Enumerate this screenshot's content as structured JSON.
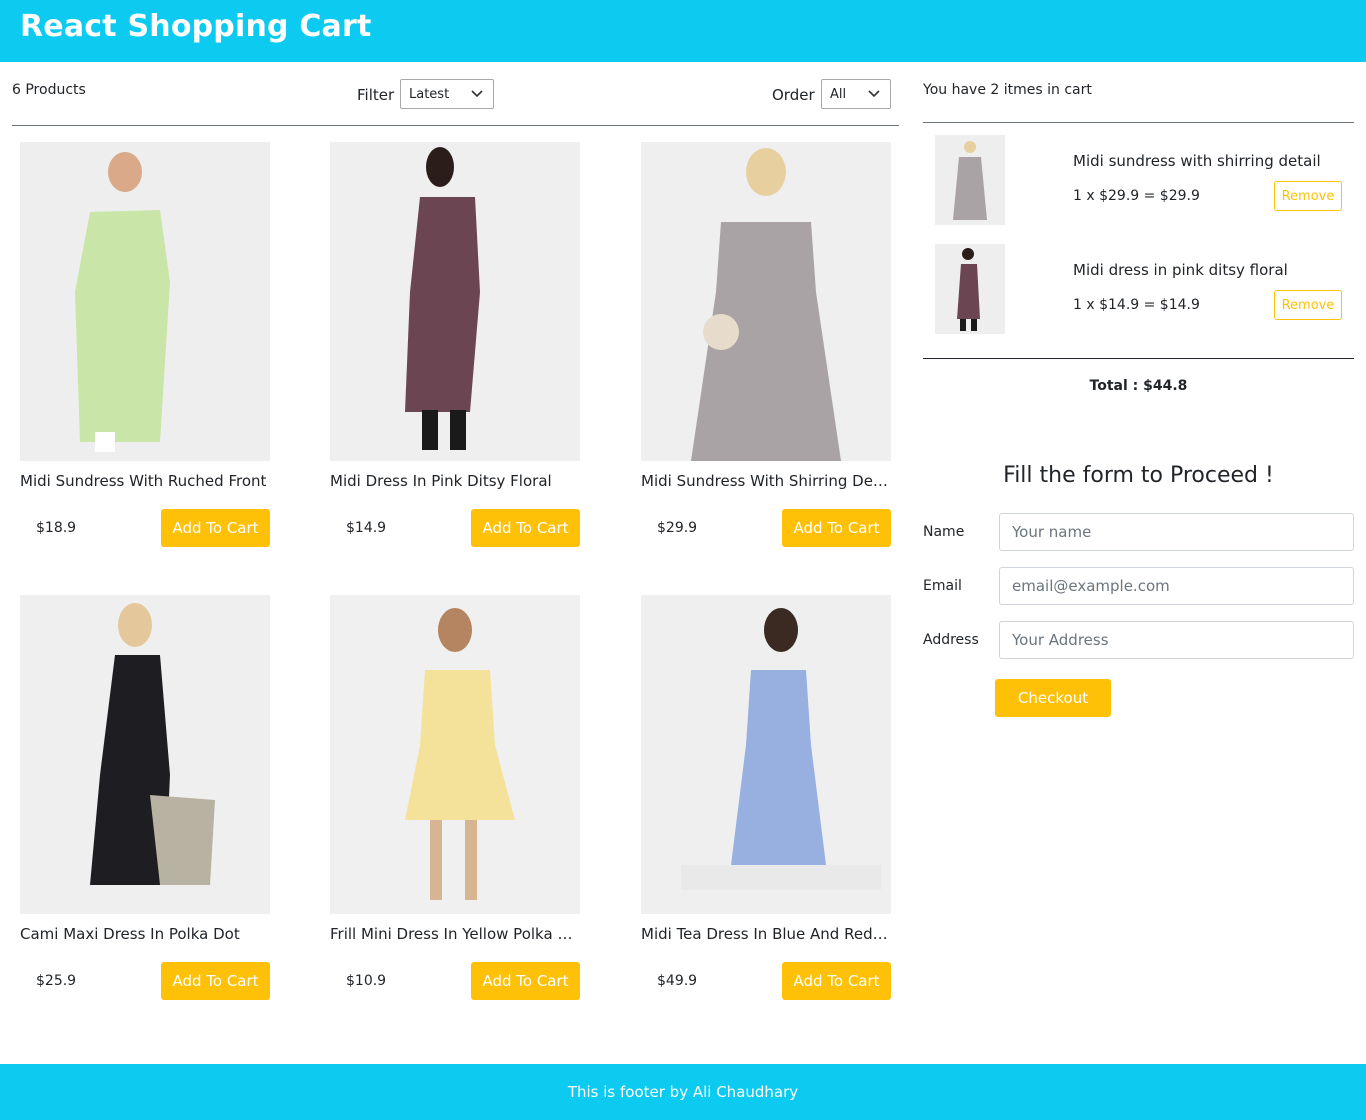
{
  "header": {
    "title": "React Shopping Cart"
  },
  "filter": {
    "count": "6 Products",
    "filter_label": "Filter",
    "filter_value": "Latest",
    "order_label": "Order",
    "order_value": "All"
  },
  "products": [
    {
      "name": "Midi Sundress With Ruched Front",
      "price": "$18.9",
      "button": "Add To Cart"
    },
    {
      "name": "Midi Dress In Pink Ditsy Floral",
      "price": "$14.9",
      "button": "Add To Cart"
    },
    {
      "name": "Midi Sundress With Shirring Detail",
      "price": "$29.9",
      "button": "Add To Cart"
    },
    {
      "name": "Cami Maxi Dress In Polka Dot",
      "price": "$25.9",
      "button": "Add To Cart"
    },
    {
      "name": "Frill Mini Dress In Yellow Polka Dot",
      "price": "$10.9",
      "button": "Add To Cart"
    },
    {
      "name": "Midi Tea Dress In Blue And Red Spot",
      "price": "$49.9",
      "button": "Add To Cart"
    }
  ],
  "cart": {
    "message": "You have 2 itmes in cart",
    "items": [
      {
        "name": "Midi sundress with shirring detail",
        "line": "1 x $29.9 = $29.9",
        "remove": "Remove"
      },
      {
        "name": "Midi dress in pink ditsy floral",
        "line": "1 x $14.9 = $14.9",
        "remove": "Remove"
      }
    ],
    "total": "Total : $44.8"
  },
  "form": {
    "title": "Fill the form to Proceed !",
    "name_label": "Name",
    "name_placeholder": "Your name",
    "email_label": "Email",
    "email_placeholder": "email@example.com",
    "address_label": "Address",
    "address_placeholder": "Your Address",
    "checkout": "Checkout"
  },
  "footer": {
    "text": "This is footer by Ali Chaudhary"
  },
  "colors": {
    "header": "#0dcaf0",
    "accent": "#ffc107",
    "text": "#212529"
  }
}
